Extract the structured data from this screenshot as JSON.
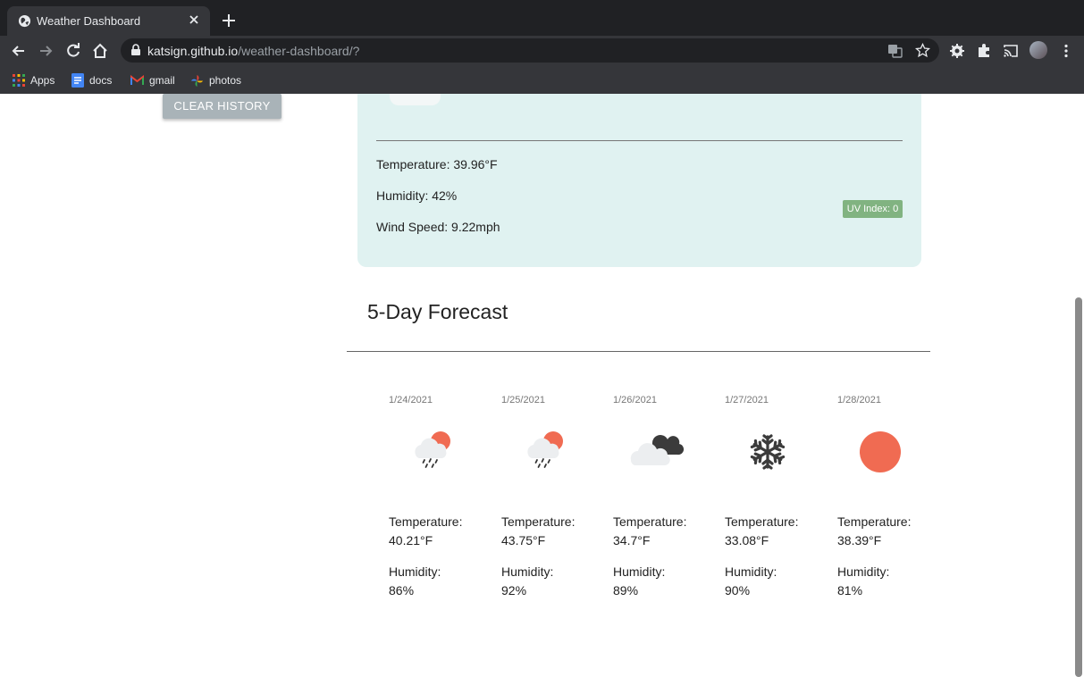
{
  "browser": {
    "tab_title": "Weather Dashboard",
    "url_host": "katsign.github.io",
    "url_path": "/weather-dashboard/?",
    "bookmarks": [
      {
        "label": "Apps",
        "icon": "apps-grid-icon"
      },
      {
        "label": "docs",
        "icon": "docs-icon"
      },
      {
        "label": "gmail",
        "icon": "gmail-icon"
      },
      {
        "label": "photos",
        "icon": "photos-icon"
      }
    ]
  },
  "sidebar": {
    "clear_history_label": "CLEAR HISTORY"
  },
  "current": {
    "temperature": "Temperature: 39.96°F",
    "humidity": "Humidity: 42%",
    "wind_speed": "Wind Speed: 9.22mph",
    "uv_index": "UV Index: 0",
    "uv_color": "#81b381"
  },
  "forecast": {
    "title": "5-Day Forecast",
    "days": [
      {
        "date": "1/24/2021",
        "icon": "rain-sun-icon",
        "temp_label": "Temperature:",
        "temp": "40.21°F",
        "humidity_label": "Humidity:",
        "humidity": "86%"
      },
      {
        "date": "1/25/2021",
        "icon": "rain-sun-icon",
        "temp_label": "Temperature:",
        "temp": "43.75°F",
        "humidity_label": "Humidity:",
        "humidity": "92%"
      },
      {
        "date": "1/26/2021",
        "icon": "clouds-icon",
        "temp_label": "Temperature:",
        "temp": "34.7°F",
        "humidity_label": "Humidity:",
        "humidity": "89%"
      },
      {
        "date": "1/27/2021",
        "icon": "snowflake-icon",
        "temp_label": "Temperature:",
        "temp": "33.08°F",
        "humidity_label": "Humidity:",
        "humidity": "90%"
      },
      {
        "date": "1/28/2021",
        "icon": "sun-icon",
        "temp_label": "Temperature:",
        "temp": "38.39°F",
        "humidity_label": "Humidity:",
        "humidity": "81%"
      }
    ]
  },
  "colors": {
    "card_background": "#e0f2f1",
    "sun": "#f06b52",
    "clear_button": "#a9b3b8"
  }
}
